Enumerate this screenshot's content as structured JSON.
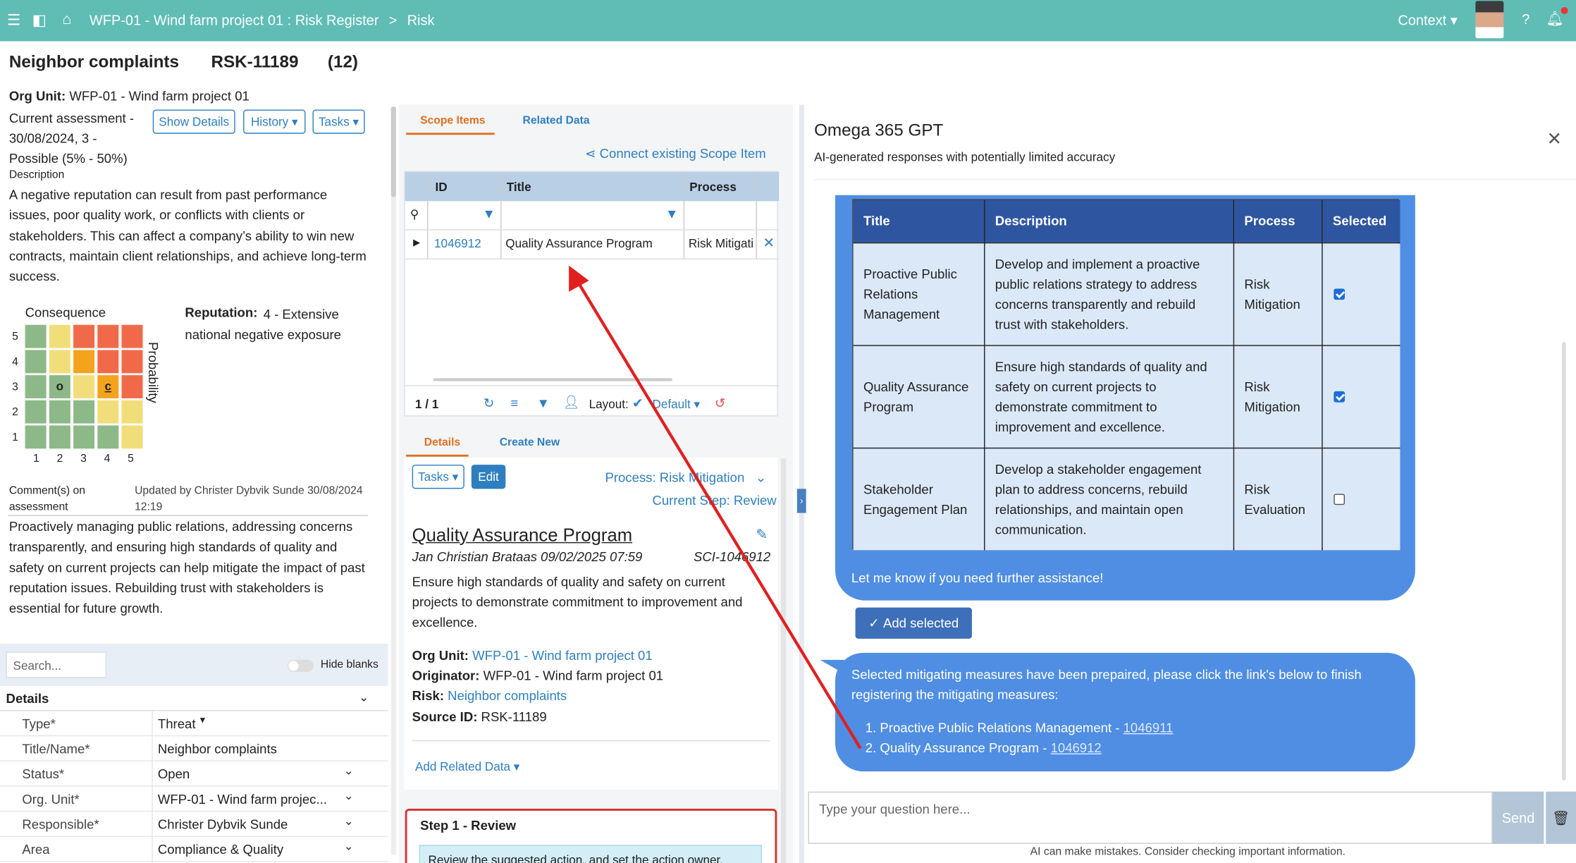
{
  "topbar": {
    "breadcrumb": "WFP-01 - Wind farm project 01 : Risk Register",
    "breadcrumb_sep": ">",
    "page": "Risk",
    "context": "Context"
  },
  "risk": {
    "title": "Neighbor complaints",
    "id": "RSK-11189",
    "count": "(12)",
    "org_unit_label": "Org Unit:",
    "org_unit": "WFP-01 - Wind farm project 01",
    "assessment": "Current assessment - 30/08/2024, 3 - Possible (5% - 50%)",
    "description_label": "Description",
    "description": "A negative reputation can result from past performance issues, poor quality work, or conflicts with clients or stakeholders. This can affect a company’s ability to win new contracts, maintain client relationships, and achieve long-term success.",
    "show_details": "Show Details",
    "history": "History",
    "tasks": "Tasks",
    "consequence_label": "Consequence",
    "probability_label": "Probability",
    "reputation_label": "Reputation:",
    "reputation_value": "4 - Extensive national negative exposure",
    "matrix_y": [
      "5",
      "4",
      "3",
      "2",
      "1"
    ],
    "matrix_x": [
      "1",
      "2",
      "3",
      "4",
      "5"
    ],
    "marker_o": "o",
    "marker_c": "c",
    "comment_label": "Comment(s) on assessment",
    "updated_by": "Updated by Christer Dybvik Sunde 30/08/2024 12:19",
    "comment": "Proactively managing public relations, addressing concerns transparently, and ensuring high standards of quality and safety on current projects can help mitigate the impact of past reputation issues. Rebuilding trust with stakeholders is essential for future growth.",
    "search_placeholder": "Search...",
    "hide_blanks": "Hide blanks",
    "details_header": "Details",
    "fields": [
      {
        "k": "Type*",
        "v": "Threat"
      },
      {
        "k": "Title/Name*",
        "v": "Neighbor complaints"
      },
      {
        "k": "Status*",
        "v": "Open"
      },
      {
        "k": "Org. Unit*",
        "v": "WFP-01 - Wind farm projec..."
      },
      {
        "k": "Responsible*",
        "v": "Christer Dybvik Sunde"
      },
      {
        "k": "Area",
        "v": "Compliance & Quality"
      }
    ]
  },
  "scope": {
    "tab_scope": "Scope Items",
    "tab_related": "Related Data",
    "connect": "Connect existing Scope Item",
    "col_id": "ID",
    "col_title": "Title",
    "col_process": "Process",
    "row": {
      "id": "1046912",
      "title": "Quality Assurance Program",
      "process": "Risk Mitigati"
    },
    "paging": "1 / 1",
    "layout_label": "Layout:",
    "layout_value": "Default"
  },
  "details": {
    "tab_details": "Details",
    "tab_create": "Create New",
    "tasks": "Tasks",
    "edit": "Edit",
    "process": "Process: Risk Mitigation",
    "step": "Current Step: Review",
    "title": "Quality Assurance Program",
    "author": "Jan Christian Brataas 09/02/2025 07:59",
    "sci": "SCI-1046912",
    "body": "Ensure high standards of quality and safety on current projects to demonstrate commitment to improvement and excellence.",
    "org_label": "Org Unit:",
    "org": "WFP-01 - Wind farm project 01",
    "orig_label": "Originator:",
    "orig": "WFP-01 - Wind farm project 01",
    "risk_label": "Risk:",
    "risk": "Neighbor complaints",
    "src_label": "Source ID:",
    "src": "RSK-11189",
    "add_related": "Add Related Data",
    "step_title": "Step 1 - Review",
    "step_note": "Review the suggested action, and set the action owner."
  },
  "gpt": {
    "title": "Omega 365 GPT",
    "subtitle": "AI-generated responses with potentially limited accuracy",
    "headers": [
      "Title",
      "Description",
      "Process",
      "Selected"
    ],
    "rows": [
      {
        "title": "Proactive Public Relations Management",
        "desc": "Develop and implement a proactive public relations strategy to address concerns transparently and rebuild trust with stakeholders.",
        "process": "Risk Mitigation",
        "selected": true
      },
      {
        "title": "Quality Assurance Program",
        "desc": "Ensure high standards of quality and safety on current projects to demonstrate commitment to improvement and excellence.",
        "process": "Risk Mitigation",
        "selected": true
      },
      {
        "title": "Stakeholder Engagement Plan",
        "desc": "Develop a stakeholder engagement plan to address concerns, rebuild relationships, and maintain open communication.",
        "process": "Risk Evaluation",
        "selected": false
      }
    ],
    "closing": "Let me know if you need further assistance!",
    "add_selected": "Add selected",
    "msg": "Selected mitigating measures have been prepaired, please click the link's below to finish registering the mitigating measures:",
    "links": [
      {
        "text": "1. Proactive Public Relations Management -",
        "id": "1046911"
      },
      {
        "text": "2. Quality Assurance Program -",
        "id": "1046912"
      }
    ],
    "input_placeholder": "Type your question here...",
    "send": "Send",
    "disclaimer": "AI can make mistakes. Consider checking important information."
  },
  "colors": {
    "topbar": "#5fbdb6",
    "bubble": "#4f8ee3",
    "header": "#2e55a0",
    "arrow": "#e02020"
  }
}
